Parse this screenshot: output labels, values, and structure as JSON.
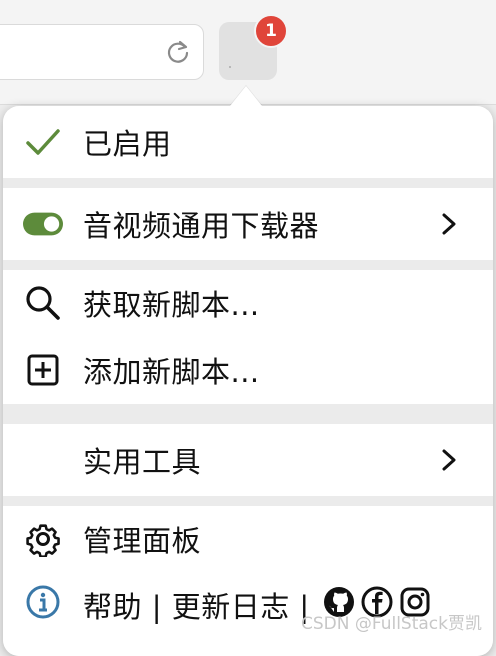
{
  "toolbar": {
    "badge_count": "1"
  },
  "menu": {
    "enabled_label": "已启用",
    "script_label": "音视频通用下载器",
    "get_scripts_label": "获取新脚本...",
    "add_script_label": "添加新脚本...",
    "utilities_label": "实用工具",
    "dashboard_label": "管理面板",
    "help_label": "帮助 | 更新日志 |"
  },
  "watermark": "CSDN @FullStack贾凯",
  "colors": {
    "accent_green": "#5d8b3b",
    "badge_red": "#e0453a",
    "popup_bg": "#ffffff",
    "separator": "#ebebeb"
  },
  "icons": [
    "reload-icon",
    "checkmark-icon",
    "toggle-icon",
    "chevron-right-icon",
    "search-icon",
    "plus-box-icon",
    "gear-icon",
    "info-icon",
    "github-icon",
    "facebook-icon",
    "instagram-icon"
  ]
}
